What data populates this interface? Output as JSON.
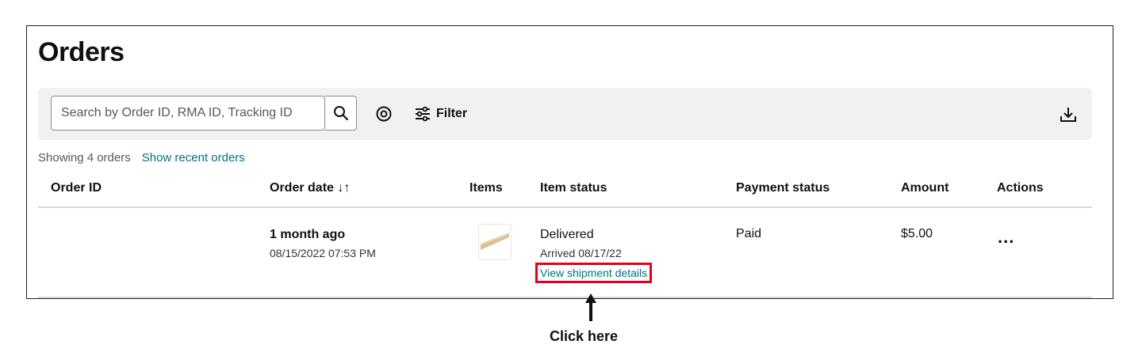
{
  "page": {
    "title": "Orders"
  },
  "toolbar": {
    "search_placeholder": "Search by Order ID, RMA ID, Tracking ID",
    "search_icon": "search-icon",
    "visibility_icon": "eye-icon",
    "filter_label": "Filter",
    "filter_icon": "sliders-icon",
    "download_icon": "download-icon"
  },
  "summary": {
    "count_text": "Showing 4 orders",
    "recent_link": "Show recent orders"
  },
  "table": {
    "columns": {
      "order_id": "Order ID",
      "order_date": "Order date ↓↑",
      "items": "Items",
      "item_status": "Item status",
      "payment_status": "Payment status",
      "amount": "Amount",
      "actions": "Actions"
    },
    "rows": [
      {
        "order_id": "",
        "date_relative": "1 month ago",
        "date_full": "08/15/2022 07:53 PM",
        "status": "Delivered",
        "arrived": "Arrived 08/17/22",
        "shipment_link": "View shipment details",
        "payment": "Paid",
        "amount": "$5.00",
        "actions": "..."
      }
    ]
  },
  "annotation": {
    "text": "Click here"
  },
  "colors": {
    "link": "#007185",
    "highlight": "#e3001b",
    "toolbar_bg": "#f0f2f2"
  }
}
